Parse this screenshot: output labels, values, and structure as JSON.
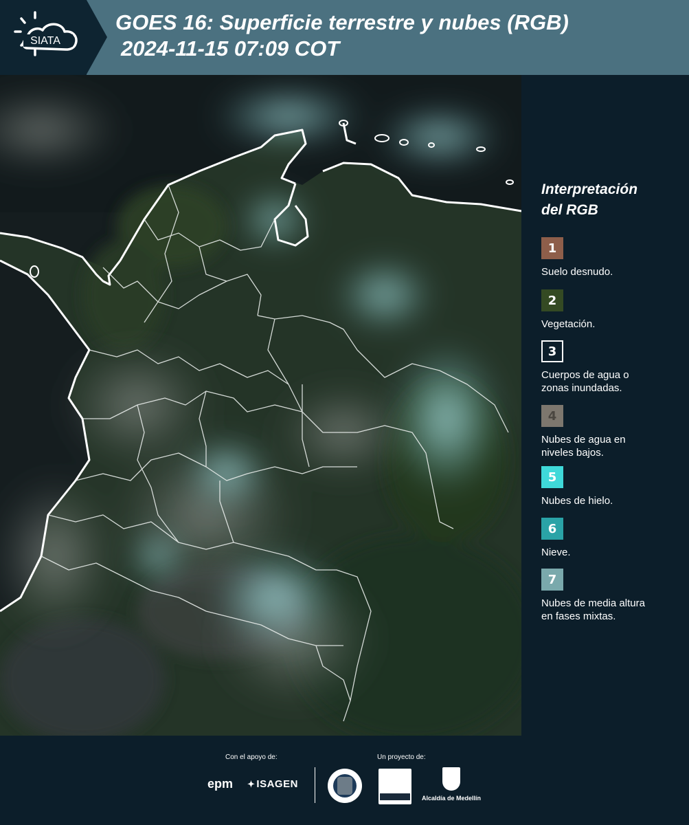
{
  "header": {
    "brand": "SIATA",
    "title_line1": "GOES 16: Superficie terrestre y nubes (RGB)",
    "title_line2": "2024-11-15 07:09 COT"
  },
  "map": {
    "type": "satellite-rgb-composite",
    "product": "Superficie terrestre y nubes (RGB)"
  },
  "legend": {
    "title_line1": "Interpretación",
    "title_line2": "del RGB",
    "items": [
      {
        "number": "1",
        "label_lines": [
          "Suelo desnudo."
        ],
        "color": "#8e5e4a",
        "border": "#8e5e4a"
      },
      {
        "number": "2",
        "label_lines": [
          "Vegetación."
        ],
        "color": "#344a23",
        "border": "#344a23"
      },
      {
        "number": "3",
        "label_lines": [
          "Cuerpos de agua o",
          "zonas inundadas."
        ],
        "color": "#0c1e2a",
        "border": "#ffffff"
      },
      {
        "number": "4",
        "label_lines": [
          "Nubes de agua en",
          "niveles bajos."
        ],
        "color": "#7d776e",
        "border": "#7d776e"
      },
      {
        "number": "5",
        "label_lines": [
          "Nubes de hielo."
        ],
        "color": "#3fd9d9",
        "border": "#3fd9d9"
      },
      {
        "number": "6",
        "label_lines": [
          "Nieve."
        ],
        "color": "#2aa3a7",
        "border": "#2aa3a7"
      },
      {
        "number": "7",
        "label_lines": [
          "Nubes de media altura",
          "en fases mixtas."
        ],
        "color": "#7aa9ac",
        "border": "#7aa9ac"
      }
    ]
  },
  "footer": {
    "support_label": "Con el apoyo de:",
    "project_label": "Un proyecto de:",
    "support_logos": [
      "epm",
      "ISAGEN"
    ],
    "project_logos": [
      "Alcaldía de Medellín"
    ]
  },
  "colors": {
    "header_bg": "#4b7180",
    "panel_bg": "#0c1e2a",
    "logo_bg": "#0e2431",
    "boundary": "#ffffff",
    "vegetation": "#2c3b25",
    "ocean": "#141c1f",
    "cloud": "#7fc8c8"
  }
}
